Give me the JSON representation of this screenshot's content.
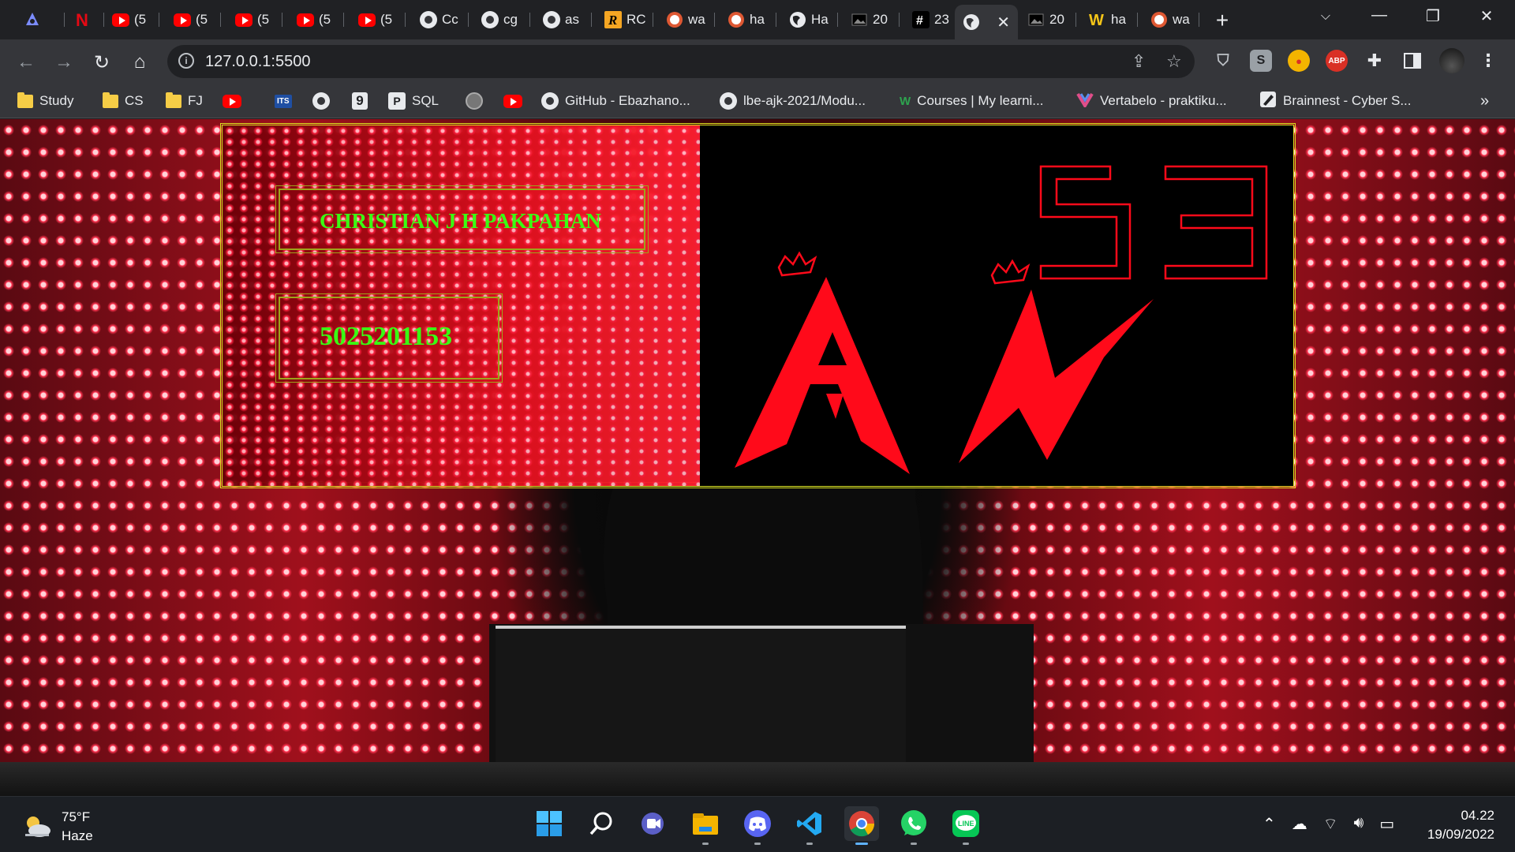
{
  "browser": {
    "tabs": [
      {
        "icon": "tor-icon",
        "title": ""
      },
      {
        "icon": "netflix-icon",
        "title": ""
      },
      {
        "icon": "youtube-icon",
        "title": "(5"
      },
      {
        "icon": "youtube-icon",
        "title": "(5"
      },
      {
        "icon": "youtube-icon",
        "title": "(5"
      },
      {
        "icon": "youtube-icon",
        "title": "(5"
      },
      {
        "icon": "youtube-icon",
        "title": "(5"
      },
      {
        "icon": "github-icon",
        "title": "Cc"
      },
      {
        "icon": "github-icon",
        "title": "cg"
      },
      {
        "icon": "github-icon",
        "title": "as"
      },
      {
        "icon": "r-icon",
        "title": "RC"
      },
      {
        "icon": "duckduckgo-icon",
        "title": "wa"
      },
      {
        "icon": "duckduckgo-icon",
        "title": "ha"
      },
      {
        "icon": "globe-icon",
        "title": "Ha"
      },
      {
        "icon": "image-icon",
        "title": "20"
      },
      {
        "icon": "hash-icon",
        "title": "23"
      },
      {
        "icon": "globe-icon",
        "title": "",
        "active": true
      },
      {
        "icon": "image-icon",
        "title": "20"
      },
      {
        "icon": "w-icon",
        "title": "ha"
      },
      {
        "icon": "duckduckgo-icon",
        "title": "wa"
      }
    ],
    "url": "127.0.0.1:5500",
    "bookmarks": [
      {
        "icon": "folder-icon",
        "label": "Study"
      },
      {
        "icon": "folder-icon",
        "label": "CS"
      },
      {
        "icon": "folder-icon",
        "label": "FJ"
      },
      {
        "icon": "youtube-icon",
        "label": ""
      },
      {
        "icon": "its-icon",
        "label": "ITS"
      },
      {
        "icon": "github-icon",
        "label": ""
      },
      {
        "icon": "nine-icon",
        "label": "9"
      },
      {
        "icon": "sql-icon",
        "label": "SQL"
      },
      {
        "icon": "seal-icon",
        "label": ""
      },
      {
        "icon": "youtube-icon",
        "label": ""
      },
      {
        "icon": "github-icon",
        "label": "GitHub - Ebazhano..."
      },
      {
        "icon": "github-icon",
        "label": "lbe-ajk-2021/Modu..."
      },
      {
        "icon": "w-icon",
        "label": "Courses | My learni..."
      },
      {
        "icon": "vertabelo-icon",
        "label": "Vertabelo - praktiku..."
      },
      {
        "icon": "pen-icon",
        "label": "Brainnest - Cyber S..."
      }
    ],
    "bookmarks_more": "»",
    "extension_abp": "ABP",
    "extension_s": "S"
  },
  "page": {
    "name": "CHRISTIAN J H PAKPAHAN",
    "nrp": "5025201153",
    "logo_text": "53",
    "colors": {
      "name": "#39ff14",
      "border": "#d8e020",
      "red": "#ff0a1a"
    }
  },
  "taskbar": {
    "weather_temp": "75°F",
    "weather_desc": "Haze",
    "time": "04.22",
    "date": "19/09/2022"
  }
}
